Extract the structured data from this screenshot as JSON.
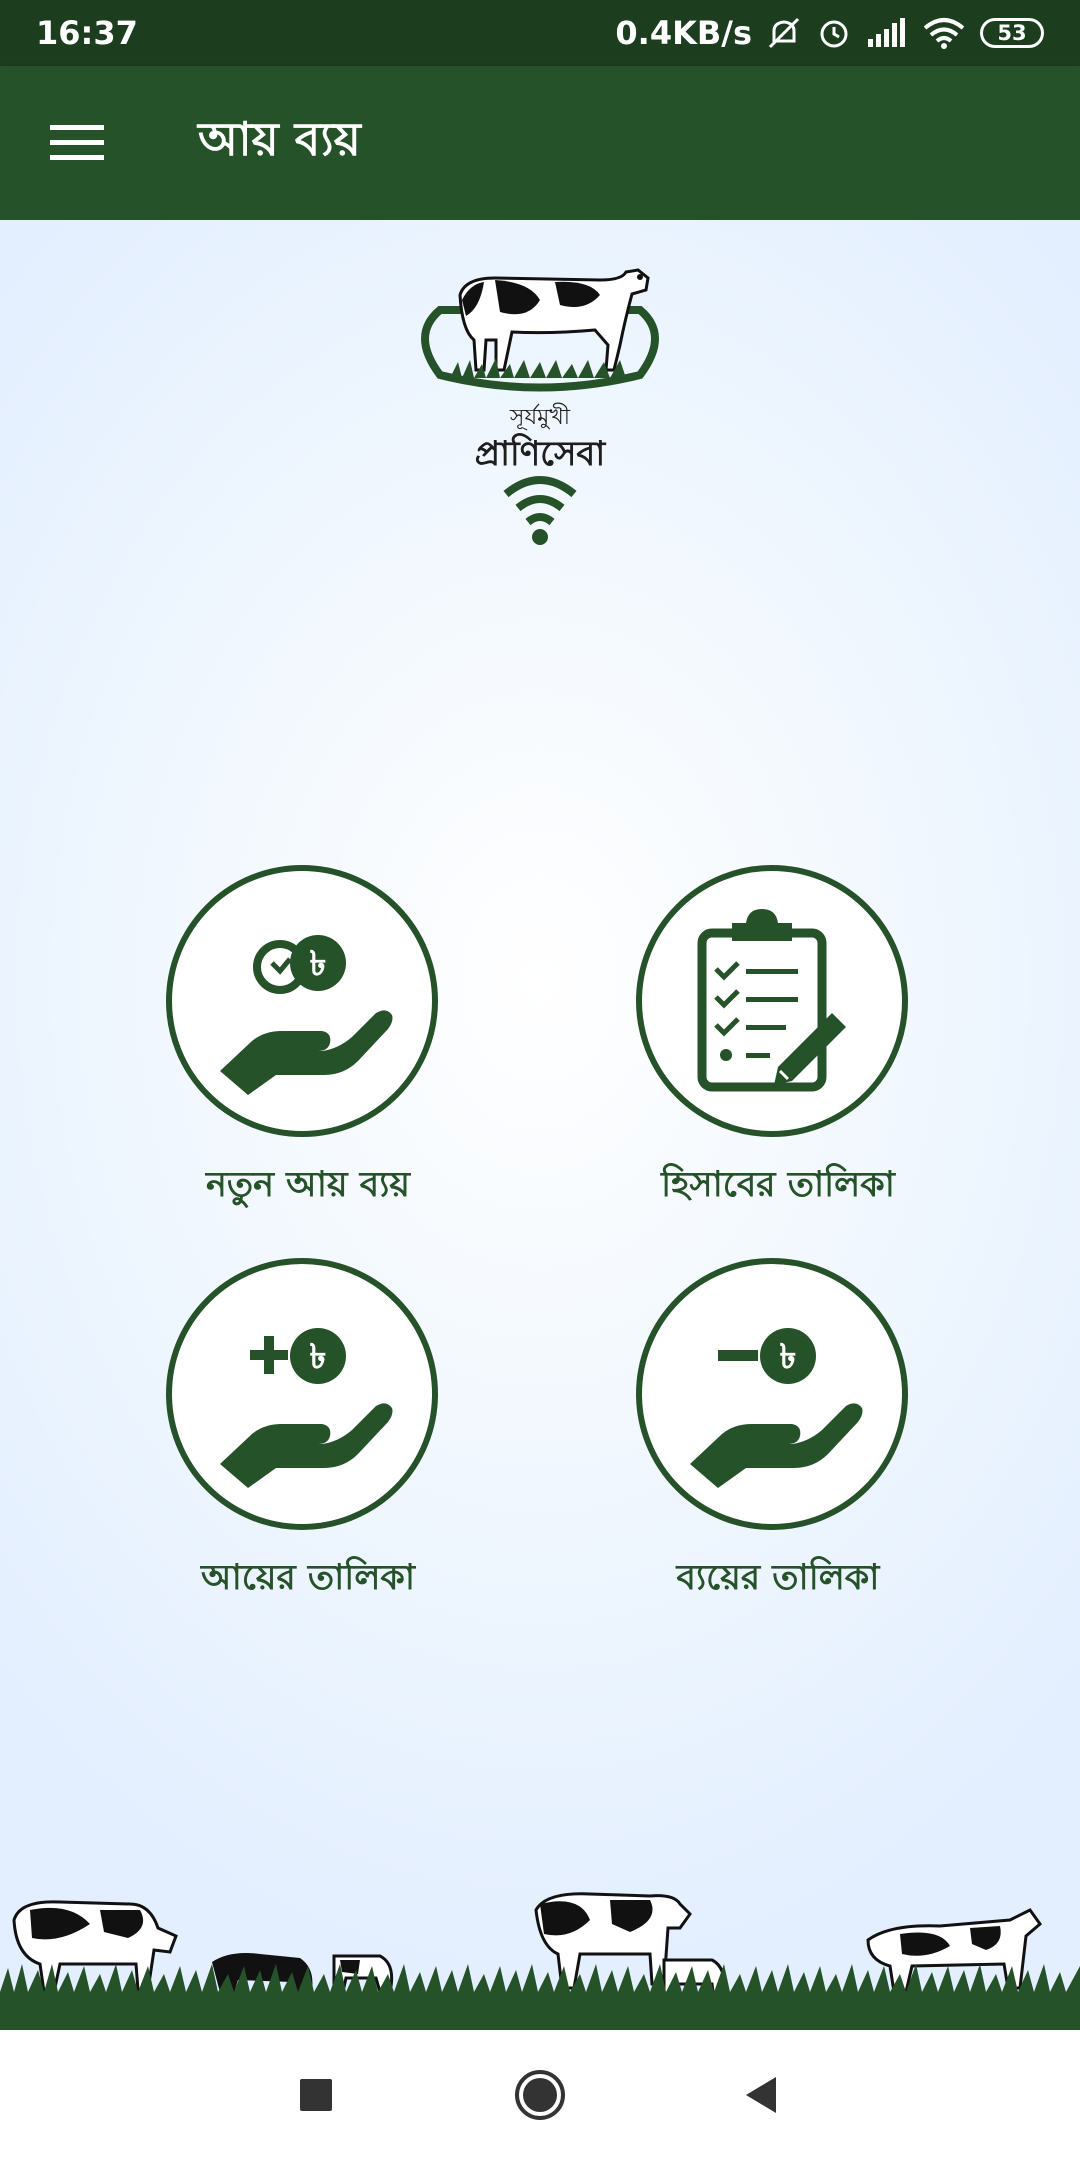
{
  "status_bar": {
    "time": "16:37",
    "network_speed": "0.4KB/s",
    "battery": "53",
    "icons": [
      "mute-icon",
      "alarm-icon",
      "signal-icon",
      "wifi-icon",
      "battery-icon"
    ]
  },
  "app_bar": {
    "title": "আয় ব্যয়",
    "menu_icon": "hamburger-menu-icon"
  },
  "logo": {
    "line1": "সূর্যমুখী",
    "line2": "প্রাণিসেবা"
  },
  "tiles": [
    {
      "label": "নতুন আয় ব্যয়",
      "icon": "new-income-expense-icon"
    },
    {
      "label": "হিসাবের তালিকা",
      "icon": "clipboard-checklist-icon"
    },
    {
      "label": "আয়ের তালিকা",
      "icon": "income-plus-icon"
    },
    {
      "label": "ব্যয়ের তালিকা",
      "icon": "expense-minus-icon"
    }
  ],
  "nav_bar": {
    "buttons": [
      "recents-square-icon",
      "home-circle-icon",
      "back-triangle-icon"
    ]
  },
  "colors": {
    "primary_dark": "#265229",
    "status_bar": "#1c3d1e",
    "background": "#eaf3fe"
  }
}
